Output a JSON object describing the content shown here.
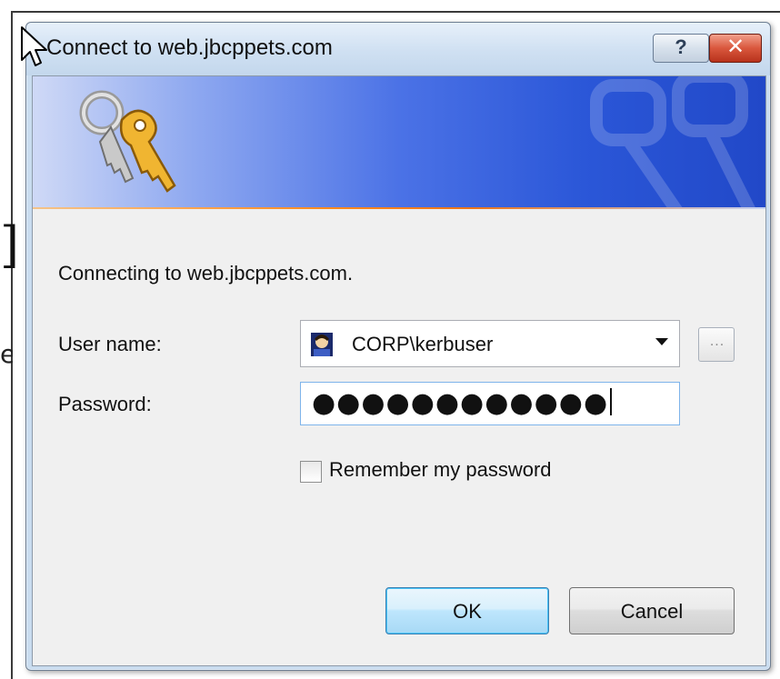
{
  "window": {
    "title": "Connect to web.jbcppets.com",
    "help_label": "?",
    "close_label": "✕"
  },
  "dialog": {
    "message": "Connecting to web.jbcppets.com.",
    "user_name_label": "User name:",
    "user_name_value": "CORP\\kerbuser",
    "browse_label": "...",
    "password_label": "Password:",
    "password_value": "●●●●●●●●●●●●",
    "remember_label": "Remember my password",
    "remember_checked": false,
    "ok_label": "OK",
    "cancel_label": "Cancel"
  },
  "colors": {
    "banner_accent": "#2b57d8",
    "banner_stripe": "#ff8a1e",
    "ok_focus": "#48c4f8",
    "close_red": "#d9573d"
  },
  "icons": {
    "banner": "keys-icon",
    "user": "user-avatar-icon",
    "dropdown": "chevron-down-icon",
    "cursor": "mouse-pointer-icon"
  }
}
